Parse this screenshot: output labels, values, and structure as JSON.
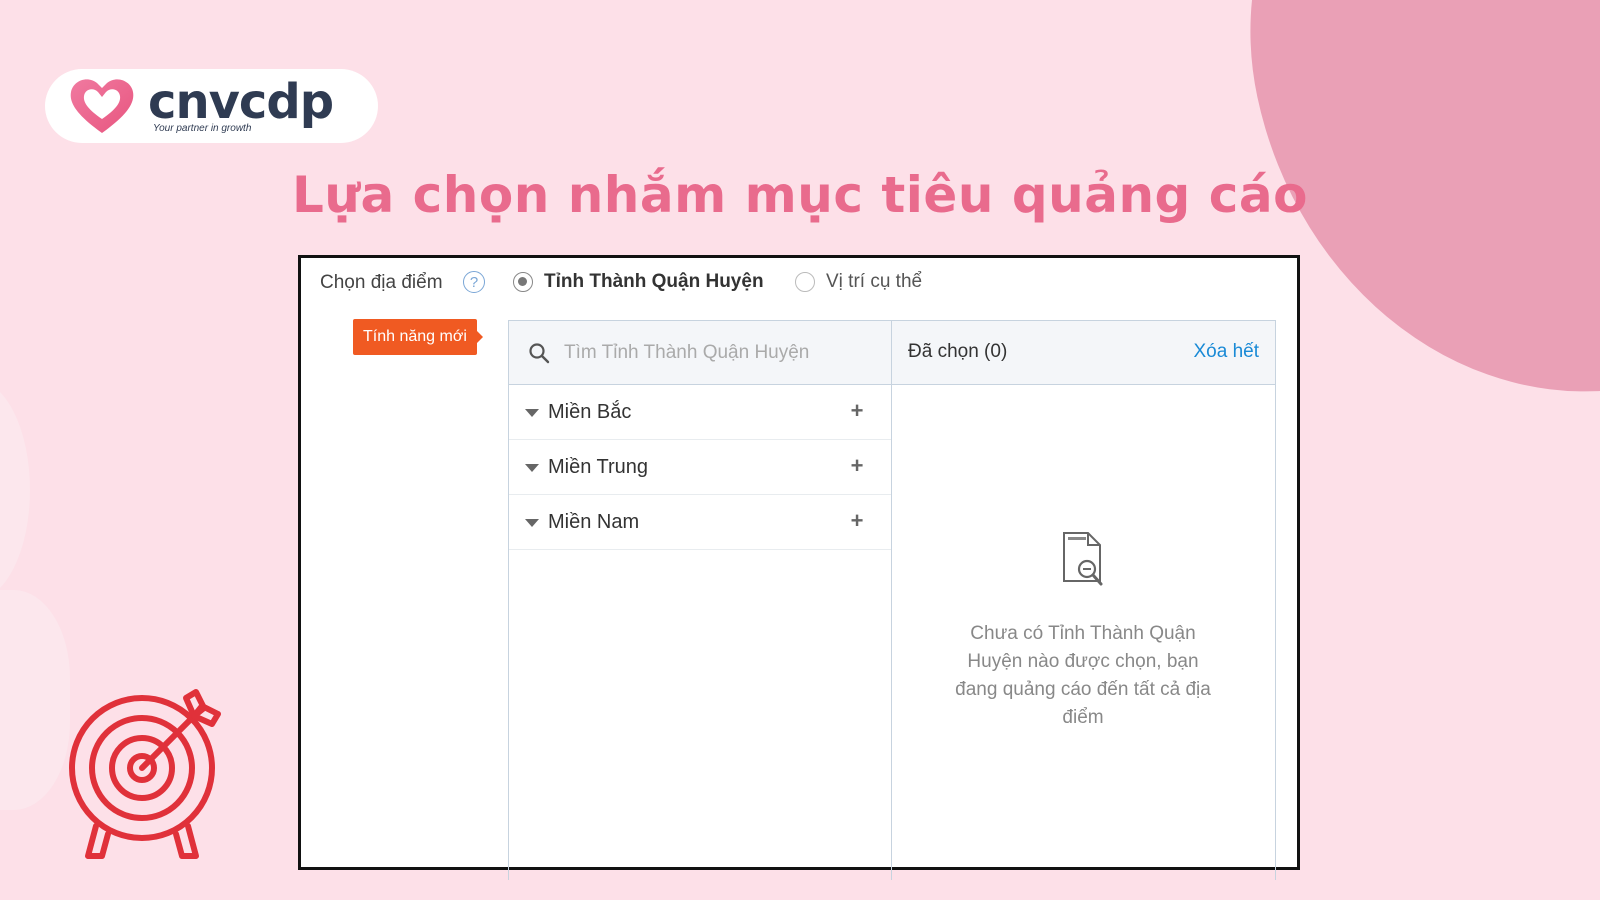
{
  "brand": {
    "name": "cnvcdp",
    "tagline": "Your partner in growth"
  },
  "headline": "Lựa chọn nhắm mục tiêu quảng cáo",
  "location_picker": {
    "label": "Chọn địa điểm",
    "help_icon": "question-circle-icon",
    "options": [
      {
        "label": "Tỉnh Thành Quận Huyện",
        "selected": true
      },
      {
        "label": "Vị trí cụ thể",
        "selected": false
      }
    ],
    "new_badge": "Tính năng mới",
    "search": {
      "placeholder": "Tìm Tỉnh Thành Quận Huyện",
      "value": ""
    },
    "regions": [
      {
        "label": "Miền Bắc"
      },
      {
        "label": "Miền Trung"
      },
      {
        "label": "Miền Nam"
      }
    ],
    "selected_label": "Đã chọn (0)",
    "clear_all": "Xóa hết",
    "empty_message": "Chưa có Tỉnh Thành Quận Huyện nào được chọn, bạn đang quảng cáo đến tất cả địa điểm"
  },
  "colors": {
    "background": "#fde0e8",
    "headline": "#e96b8d",
    "badge": "#f05a22",
    "link": "#1a8ad6",
    "target_icon": "#e0313a"
  }
}
